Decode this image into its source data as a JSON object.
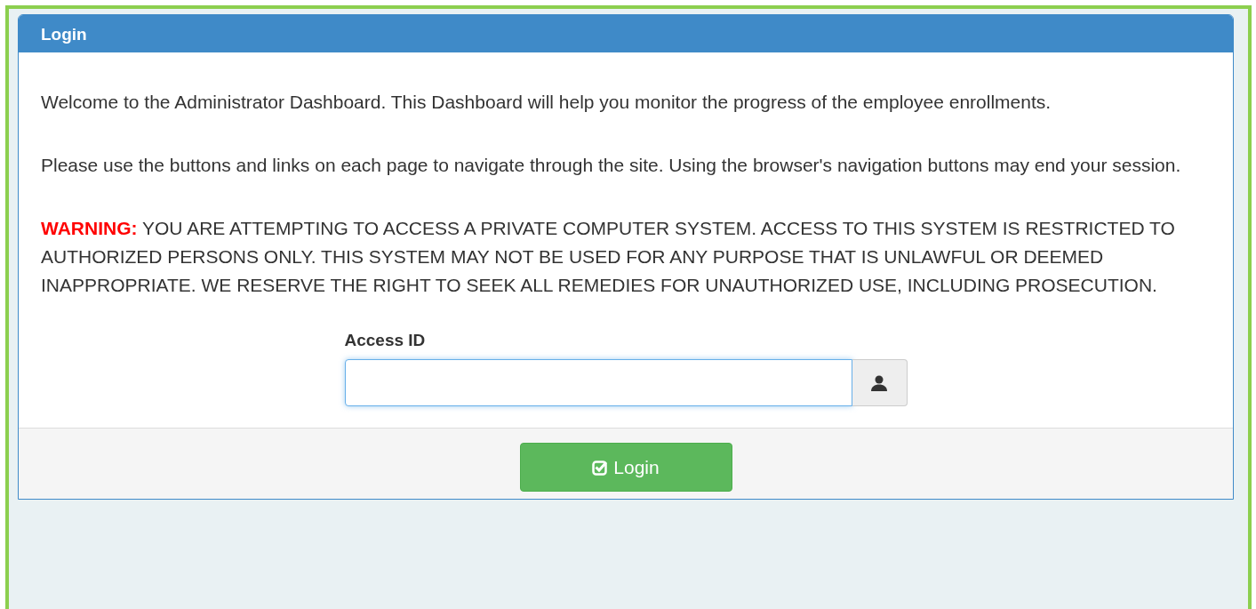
{
  "panel": {
    "title": "Login"
  },
  "paragraphs": [
    "Welcome to the Administrator Dashboard. This Dashboard will help you monitor the progress of the employee enrollments.",
    "Please use the buttons and links on each page to navigate through the site. Using the browser's navigation buttons may end your session.",
    "**WARNING:** YOU ARE ATTEMPTING TO ACCESS A PRIVATE COMPUTER SYSTEM. ACCESS TO THIS SYSTEM IS RESTRICTED TO AUTHORIZED PERSONS ONLY. THIS SYSTEM MAY NOT BE USED FOR ANY PURPOSE THAT IS UNLAWFUL OR DEEMED INAPPROPRIATE. WE RESERVE THE RIGHT TO SEEK ALL REMEDIES FOR UNAUTHORIZED USE, INCLUDING PROSECUTION."
  ],
  "field": {
    "label": "Access ID",
    "focused": true
  },
  "button": {
    "label": "Login"
  }
}
